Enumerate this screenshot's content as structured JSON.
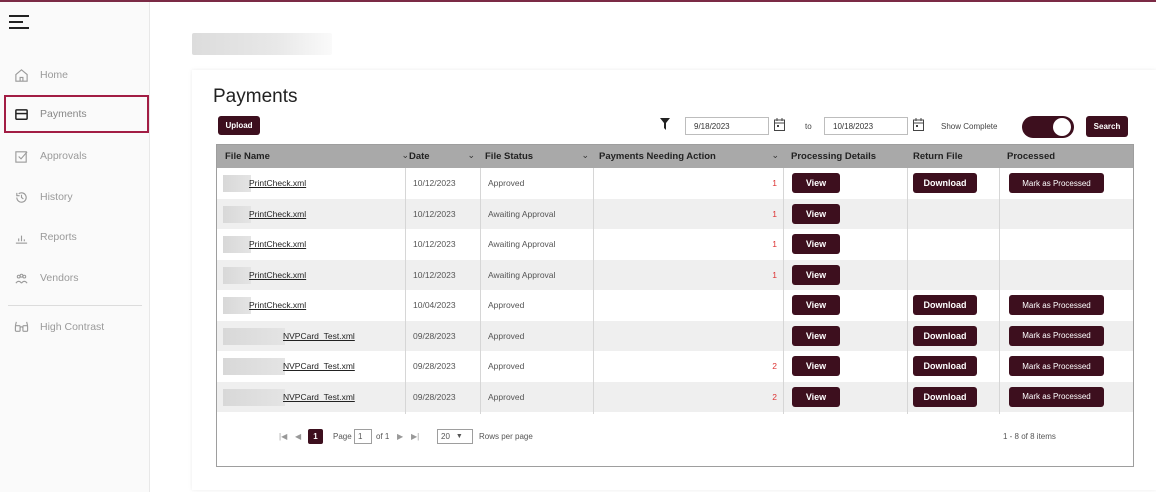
{
  "sidebar": {
    "items": [
      {
        "label": "Home",
        "icon": "home-icon"
      },
      {
        "label": "Payments",
        "icon": "payments-icon",
        "active": true
      },
      {
        "label": "Approvals",
        "icon": "approvals-icon"
      },
      {
        "label": "History",
        "icon": "history-icon"
      },
      {
        "label": "Reports",
        "icon": "reports-icon"
      },
      {
        "label": "Vendors",
        "icon": "vendors-icon"
      }
    ],
    "high_contrast": "High Contrast"
  },
  "page": {
    "title": "Payments",
    "upload_label": "Upload",
    "from_date": "9/18/2023",
    "to_label": "to",
    "to_date": "10/18/2023",
    "show_complete_label": "Show Complete",
    "show_complete_on": true,
    "search_label": "Search"
  },
  "grid": {
    "columns": [
      "File Name",
      "Date",
      "File Status",
      "Payments Needing Action",
      "Processing Details",
      "Return File",
      "Processed"
    ],
    "view_label": "View",
    "download_label": "Download",
    "mark_label": "Mark as Processed",
    "rows": [
      {
        "file": "PrintCheck.xml",
        "date": "10/12/2023",
        "status": "Approved",
        "count": "1",
        "download": true,
        "mark": true
      },
      {
        "file": "PrintCheck.xml",
        "date": "10/12/2023",
        "status": "Awaiting Approval",
        "count": "1",
        "download": false,
        "mark": false
      },
      {
        "file": "PrintCheck.xml",
        "date": "10/12/2023",
        "status": "Awaiting Approval",
        "count": "1",
        "download": false,
        "mark": false
      },
      {
        "file": "PrintCheck.xml",
        "date": "10/12/2023",
        "status": "Awaiting Approval",
        "count": "1",
        "download": false,
        "mark": false
      },
      {
        "file": "PrintCheck.xml",
        "date": "10/04/2023",
        "status": "Approved",
        "count": "",
        "download": true,
        "mark": true
      },
      {
        "file": "NVPCard_Test.xml",
        "date": "09/28/2023",
        "status": "Approved",
        "count": "",
        "download": true,
        "mark": true
      },
      {
        "file": "NVPCard_Test.xml",
        "date": "09/28/2023",
        "status": "Approved",
        "count": "2",
        "download": true,
        "mark": true
      },
      {
        "file": "NVPCard_Test.xml",
        "date": "09/28/2023",
        "status": "Approved",
        "count": "2",
        "download": true,
        "mark": true
      }
    ]
  },
  "pager": {
    "current_page": "1",
    "page_label": "Page",
    "page_input": "1",
    "of_label": "of 1",
    "page_size": "20",
    "rows_per_page_label": "Rows per page",
    "summary": "1 - 8 of 8 items"
  },
  "colors": {
    "accent": "#3d0f1e",
    "active_border": "#a21d44",
    "count": "#dd3333"
  }
}
